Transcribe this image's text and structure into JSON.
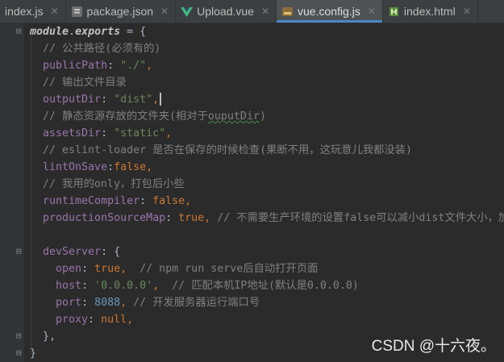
{
  "tabs": [
    {
      "label": "index.js",
      "icon": "js-file-icon",
      "active": false
    },
    {
      "label": "package.json",
      "icon": "json-file-icon",
      "active": false
    },
    {
      "label": "Upload.vue",
      "icon": "vue-file-icon",
      "active": false
    },
    {
      "label": "vue.config.js",
      "icon": "js-config-file-icon",
      "active": true
    },
    {
      "label": "index.html",
      "icon": "html-file-icon",
      "active": false
    }
  ],
  "close_glyph": "✕",
  "code": {
    "l1": {
      "a": "module",
      "b": ".",
      "c": "exports",
      "d": " = {"
    },
    "l2": "// 公共路径(必须有的)",
    "l3": {
      "key": "publicPath",
      "value": "\"./\""
    },
    "l4": "// 输出文件目录",
    "l5": {
      "key": "outputDir",
      "value": "\"dist\""
    },
    "l6": {
      "c1": "// 静态资源存放的文件夹(相对于",
      "c2": "ouputDir",
      "c3": ")"
    },
    "l7": {
      "key": "assetsDir",
      "value": "\"static\""
    },
    "l8": "// eslint-loader 是否在保存的时候检查(果断不用，这玩意儿我都没装)",
    "l9": {
      "key": "lintOnSave",
      "value": "false"
    },
    "l10": "// 我用的only，打包后小些",
    "l11": {
      "key": "runtimeCompiler",
      "value": "false"
    },
    "l12": {
      "key": "productionSourceMap",
      "value": "true",
      "comment": "// 不需要生产环境的设置false可以减小dist文件大小，加"
    },
    "l14": {
      "key": "devServer",
      "rest": ": {"
    },
    "l15": {
      "key": "open",
      "value": "true",
      "comment": "// npm run serve后自动打开页面"
    },
    "l16": {
      "key": "host",
      "value": "'0.0.0.0'",
      "comment": "// 匹配本机IP地址(默认是0.0.0.0)"
    },
    "l17": {
      "key": "port",
      "value": "8088",
      "comment": "// 开发服务器运行端口号"
    },
    "l18": {
      "key": "proxy",
      "value": "null"
    },
    "l19": "},",
    "l20": "}"
  },
  "watermark": "CSDN @十六夜。",
  "colors": {
    "background": "#2b2b2b",
    "keyword": "#cc7832",
    "property": "#9876aa",
    "string": "#6a8759",
    "number": "#6897bb",
    "comment": "#808080",
    "active_tab_underline": "#4a88c7"
  }
}
